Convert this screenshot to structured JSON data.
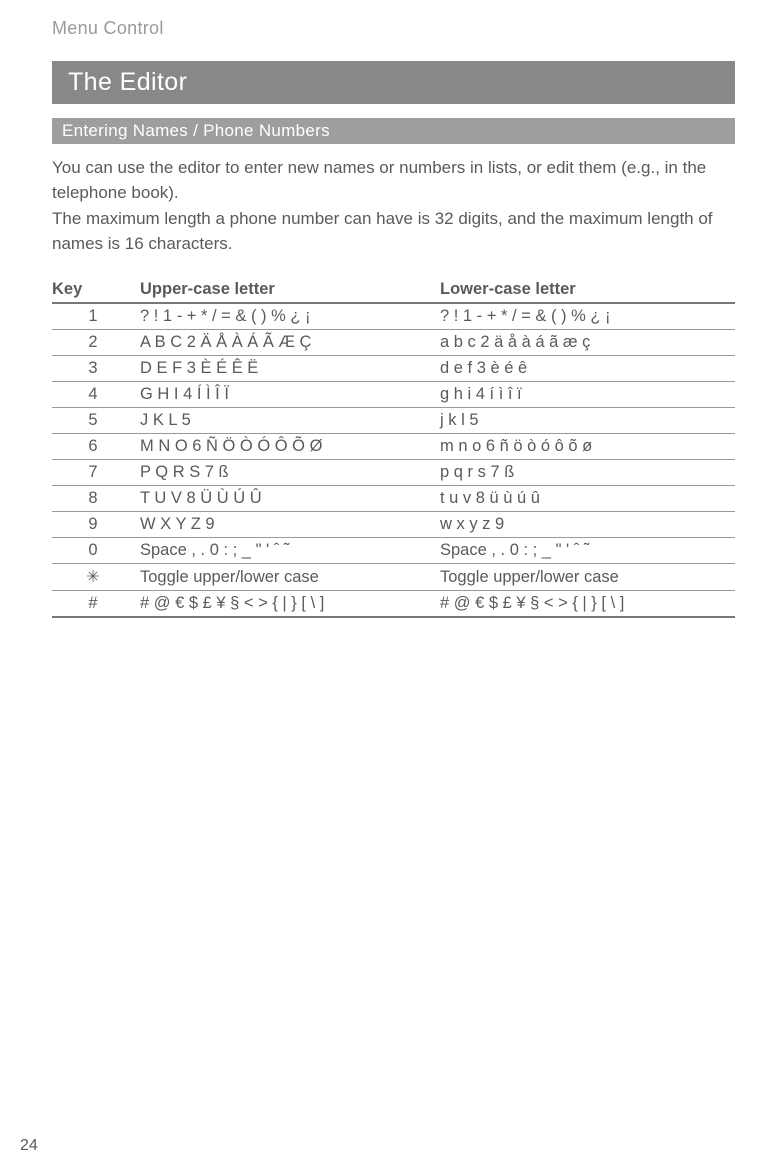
{
  "breadcrumb": "Menu Control",
  "title": "The Editor",
  "subtitle": "Entering Names / Phone Numbers",
  "para1": "You can use the editor to enter new names or numbers in lists, or edit them (e.g., in the telephone book).",
  "para2": "The maximum length a phone number can have is 32 digits, and the maximum length of names is 16 characters.",
  "table": {
    "head": {
      "key": "Key",
      "upper": "Upper-case letter",
      "lower": "Lower-case letter"
    },
    "rows": [
      {
        "key": "1",
        "upper": "? ! 1 - + * / = & ( ) % ¿ ¡",
        "lower": "? ! 1 - + * / = & ( ) % ¿ ¡"
      },
      {
        "key": "2",
        "upper": "A B C 2 Ä Å À Á Ã Æ Ç",
        "lower": "a b c 2 ä å à á ã æ ç"
      },
      {
        "key": "3",
        "upper": "D E F 3 È É Ê Ë",
        "lower": "d e f 3 è é ê"
      },
      {
        "key": "4",
        "upper": "G H I 4 Í Ì Î Ï",
        "lower": "g h i 4 í ì î ï"
      },
      {
        "key": "5",
        "upper": "J K L 5",
        "lower": "j k l 5"
      },
      {
        "key": "6",
        "upper": "M N O 6 Ñ Ö Ò Ó Ô Õ Ø",
        "lower": "m n o 6 ñ ö ò ó ô õ ø"
      },
      {
        "key": "7",
        "upper": "P Q R S 7 ß",
        "lower": "p q r s 7 ß"
      },
      {
        "key": "8",
        "upper": "T U V 8 Ü Ù Ú Û",
        "lower": "t u v 8 ü ù ú û"
      },
      {
        "key": "9",
        "upper": "W X Y Z 9",
        "lower": "w x y z 9"
      },
      {
        "key": "0",
        "upper": "Space , . 0 : ; _ \" ' ˆ ˜",
        "lower": "Space , . 0 : ; _ \" ' ˆ ˜"
      },
      {
        "key": "✳",
        "upper": "Toggle upper/lower case",
        "lower": "Toggle upper/lower case"
      },
      {
        "key": "#",
        "upper": "# @ € $ £ ¥ § < > { | } [ \\ ]",
        "lower": "# @ € $ £ ¥ § < > { | } [ \\ ]"
      }
    ]
  },
  "pageNumber": "24"
}
